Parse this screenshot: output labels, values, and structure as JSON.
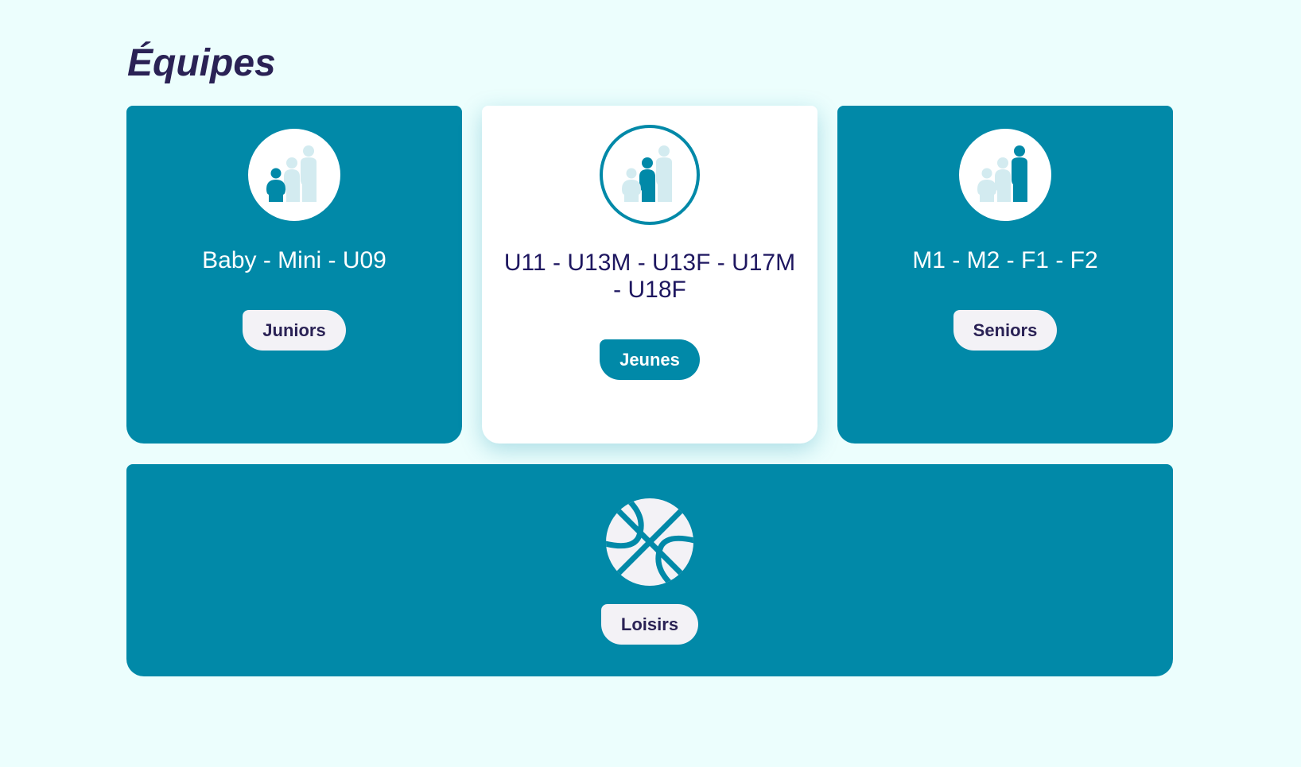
{
  "page": {
    "title": "Équipes"
  },
  "cards": [
    {
      "label": "Baby - Mini - U09",
      "button": "Juniors",
      "icon": "family-small-highlight-icon"
    },
    {
      "label": "U11 - U13M - U13F - U17M - U18F",
      "button": "Jeunes",
      "icon": "family-medium-highlight-icon"
    },
    {
      "label": "M1 - M2 - F1 - F2",
      "button": "Seniors",
      "icon": "family-tall-highlight-icon"
    }
  ],
  "leisure": {
    "button": "Loisirs",
    "icon": "basketball-icon"
  },
  "colors": {
    "background": "#ecfefd",
    "teal": "#0189a8",
    "navy": "#2a2255",
    "light_figure": "#d3ebf0",
    "pill_light": "#f3f2f6"
  }
}
